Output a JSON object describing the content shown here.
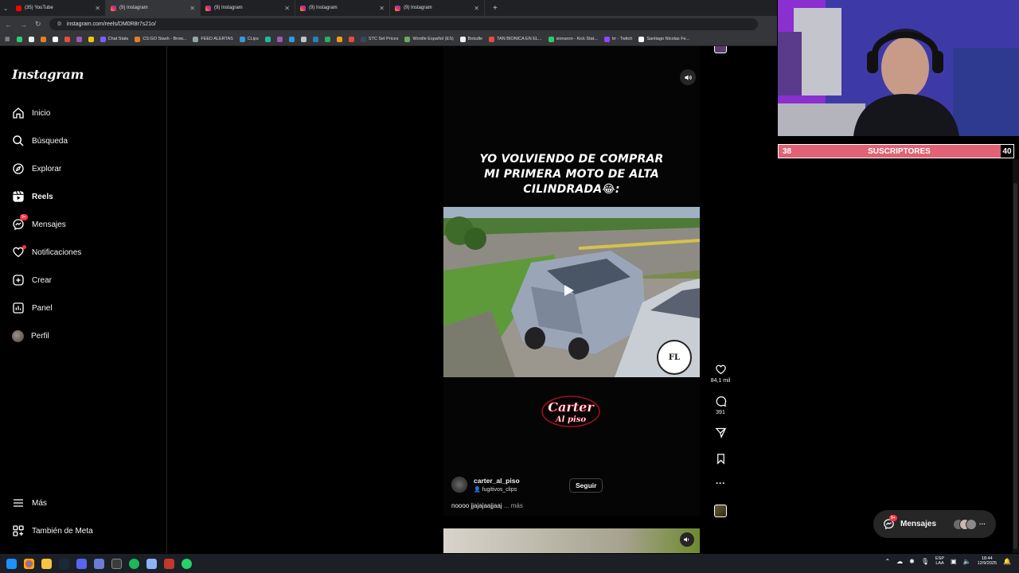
{
  "browser": {
    "tabs": [
      {
        "label": "(35) YouTube",
        "icon": "youtube-icon",
        "active": false
      },
      {
        "label": "(9) Instagram",
        "icon": "instagram-icon",
        "active": true
      },
      {
        "label": "(9) Instagram",
        "icon": "instagram-icon",
        "active": false
      },
      {
        "label": "(9) Instagram",
        "icon": "instagram-icon",
        "active": false
      },
      {
        "label": "(9) Instagram",
        "icon": "instagram-icon",
        "active": false
      }
    ],
    "new_tab": "+",
    "url": "instagram.com/reels/DM0R8r7s21o/",
    "bookmarks": [
      {
        "label": "",
        "color": "#2ecc71"
      },
      {
        "label": "",
        "color": "#eeeeee"
      },
      {
        "label": "",
        "color": "#e67e22"
      },
      {
        "label": "",
        "color": "#ffffff"
      },
      {
        "label": "",
        "color": "#e74c3c"
      },
      {
        "label": "",
        "color": "#9b59b6"
      },
      {
        "label": "",
        "color": "#f1c40f"
      },
      {
        "label": "Chat Stats",
        "color": "#7d5fff"
      },
      {
        "label": "CS:GO Stash - Brow...",
        "color": "#e67e22"
      },
      {
        "label": "FEED ALERTAS",
        "color": "#95a5a6"
      },
      {
        "label": "CLips",
        "color": "#3498db"
      },
      {
        "label": "",
        "color": "#1abc9c"
      },
      {
        "label": "",
        "color": "#9b59b6"
      },
      {
        "label": "",
        "color": "#3498db"
      },
      {
        "label": "",
        "color": "#bdc3c7"
      },
      {
        "label": "",
        "color": "#2980b9"
      },
      {
        "label": "",
        "color": "#27ae60"
      },
      {
        "label": "",
        "color": "#f39c12"
      },
      {
        "label": "",
        "color": "#e74c3c"
      },
      {
        "label": "STC Set Prices",
        "color": "#34495e"
      },
      {
        "label": "Wordle Español (ES)",
        "color": "#6aaa64"
      },
      {
        "label": "Boludle",
        "color": "#ecf0f1"
      },
      {
        "label": "TAN BIONICA EN EL...",
        "color": "#e74c3c"
      },
      {
        "label": "sionaron - Kick Stat...",
        "color": "#2ecc71"
      },
      {
        "label": "trr - Twitch",
        "color": "#9146ff"
      },
      {
        "label": "Santiago Nicolas Fe...",
        "color": "#ffffff"
      }
    ]
  },
  "instagram": {
    "logo": "Instagram",
    "nav": [
      {
        "key": "home",
        "label": "Inicio"
      },
      {
        "key": "search",
        "label": "Búsqueda"
      },
      {
        "key": "explore",
        "label": "Explorar"
      },
      {
        "key": "reels",
        "label": "Reels"
      },
      {
        "key": "messages",
        "label": "Mensajes",
        "badge": "9+"
      },
      {
        "key": "notifications",
        "label": "Notificaciones"
      },
      {
        "key": "create",
        "label": "Crear"
      },
      {
        "key": "panel",
        "label": "Panel"
      },
      {
        "key": "profile",
        "label": "Perfil"
      }
    ],
    "more": "Más",
    "meta": "También de Meta",
    "reel": {
      "overlay_text_1": "YO VOLVIENDO DE COMPRAR",
      "overlay_text_2": "MI PRIMERA MOTO DE ALTA",
      "overlay_text_3": "CILINDRADA😂:",
      "watermark": "FL",
      "logo_text_1": "Carter",
      "logo_text_2": "Al piso",
      "author": "carter_al_piso",
      "collab": "fugitivos_clips",
      "follow": "Seguir",
      "caption": "noooo jjajajaajjaaj",
      "caption_more": "... más",
      "likes": "84,1 mil",
      "comments": "391"
    },
    "messages_pill": {
      "label": "Mensajes",
      "badge": "9+"
    }
  },
  "stream_overlay": {
    "subs_current": "38",
    "subs_label": "SUSCRIPTORES",
    "subs_goal": "40"
  },
  "taskbar": {
    "lang_1": "ESP",
    "lang_2": "LAA",
    "time": "18:44",
    "date": "12/9/2025"
  }
}
